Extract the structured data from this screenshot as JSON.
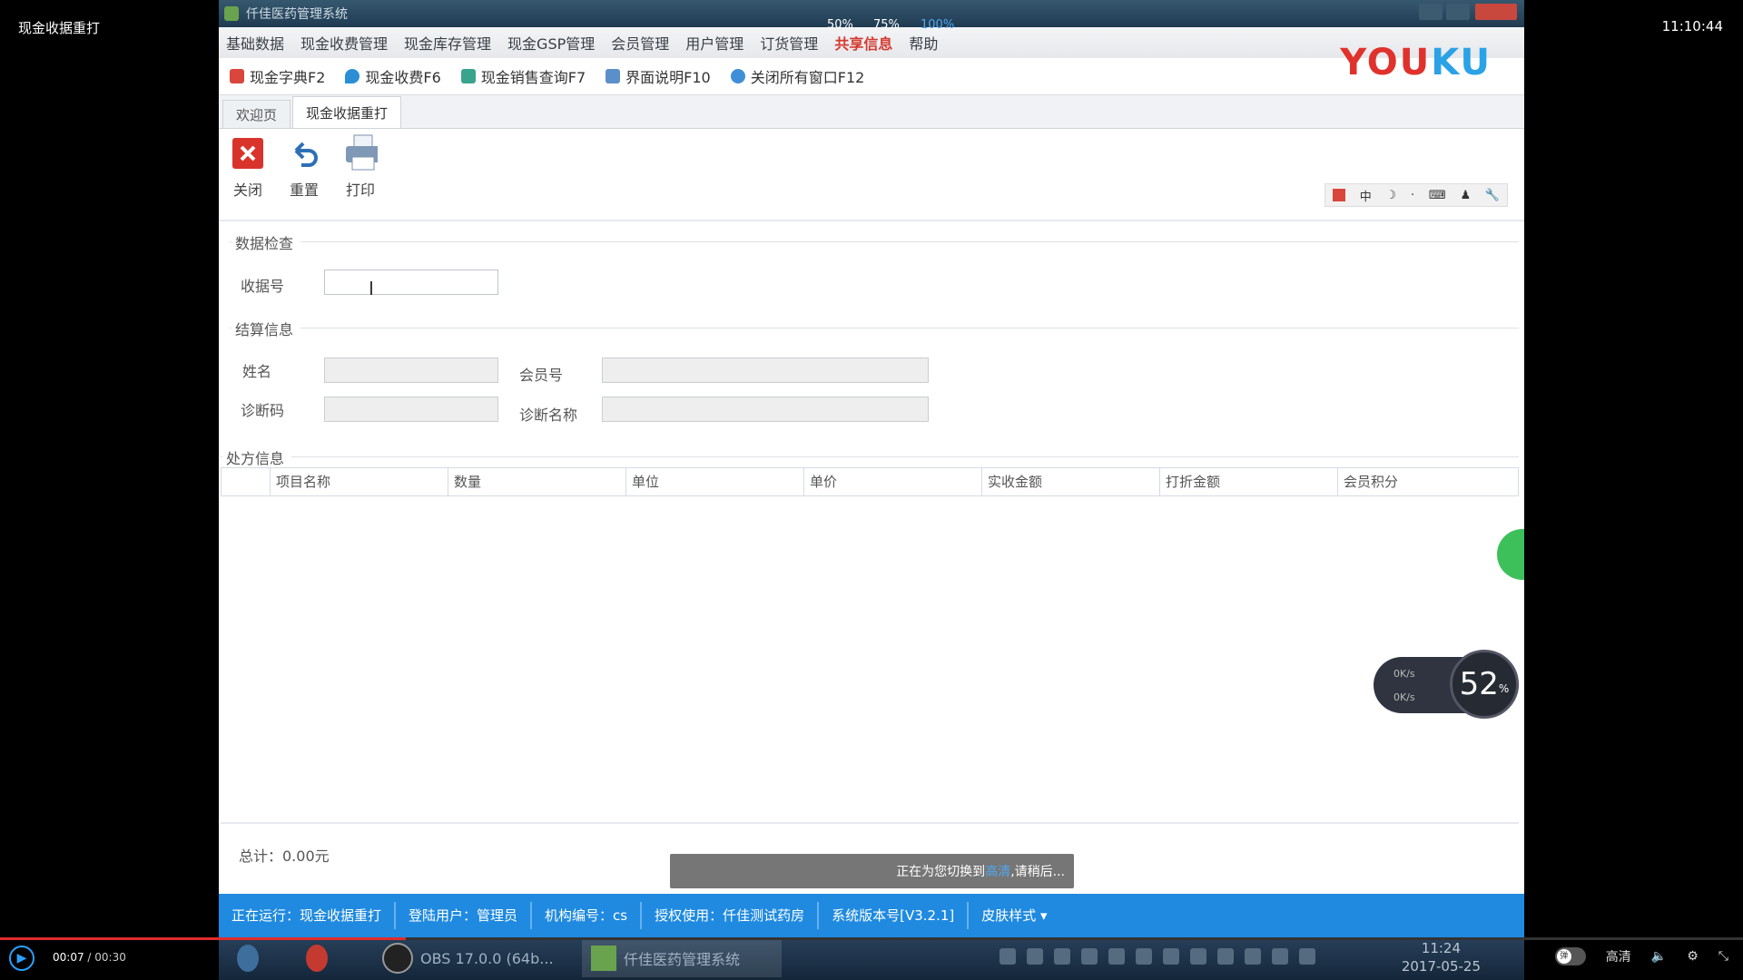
{
  "player": {
    "title": "现金收据重打",
    "clock": "11:10:44",
    "time_current": "00:07",
    "time_total": "00:30",
    "time_sep": " / ",
    "progress": 0.233,
    "quality": "高清",
    "toggle_label": "弹"
  },
  "app": {
    "window_title": "仟佳医药管理系统",
    "zoom_options": [
      "50%",
      "75%",
      "100%"
    ],
    "menu": [
      "基础数据",
      "现金收费管理",
      "现金库存管理",
      "现金GSP管理",
      "会员管理",
      "用户管理",
      "订货管理",
      "共享信息",
      "帮助"
    ],
    "quick": [
      "现金字典F2",
      "现金收费F6",
      "现金销售查询F7",
      "界面说明F10",
      "关闭所有窗口F12"
    ],
    "logo": {
      "you": "YOU",
      "ku": "KU"
    },
    "tabs": [
      "欢迎页",
      "现金收据重打"
    ],
    "toolbar": {
      "close": "关闭",
      "reset": "重置",
      "print": "打印"
    },
    "ime": [
      "中",
      "·",
      "，",
      "⌨"
    ],
    "sections": {
      "search": "数据检查",
      "settle": "结算信息",
      "prescription": "处方信息"
    },
    "labels": {
      "receipt_no": "收据号",
      "name": "姓名",
      "member_no": "会员号",
      "diag_code": "诊断码",
      "diag_name": "诊断名称"
    },
    "grid_columns": [
      "项目名称",
      "数量",
      "单位",
      "单价",
      "实收金额",
      "打折金额",
      "会员积分"
    ],
    "total": "总计：0.00元",
    "toast": {
      "prefix": "正在为您切换到",
      "highlight": "高清",
      "suffix": ",请稍后..."
    },
    "net": {
      "percent": "52",
      "percent_unit": "%",
      "up": "0K/s",
      "down": "0K/s"
    },
    "status": [
      "正在运行：现金收据重打",
      "登陆用户：管理员",
      "机构编号：cs",
      "授权使用：仟佳测试药房",
      "系统版本号[V3.2.1]",
      "皮肤样式 ▾"
    ]
  },
  "taskbar": {
    "items": [
      "OBS 17.0.0 (64b...",
      "仟佳医药管理系统"
    ],
    "time": "11:24",
    "date": "2017-05-25"
  },
  "colors": {
    "accent": "#1f8ae0",
    "progress": "#e12b2b",
    "hot_menu": "#d43a2f"
  }
}
